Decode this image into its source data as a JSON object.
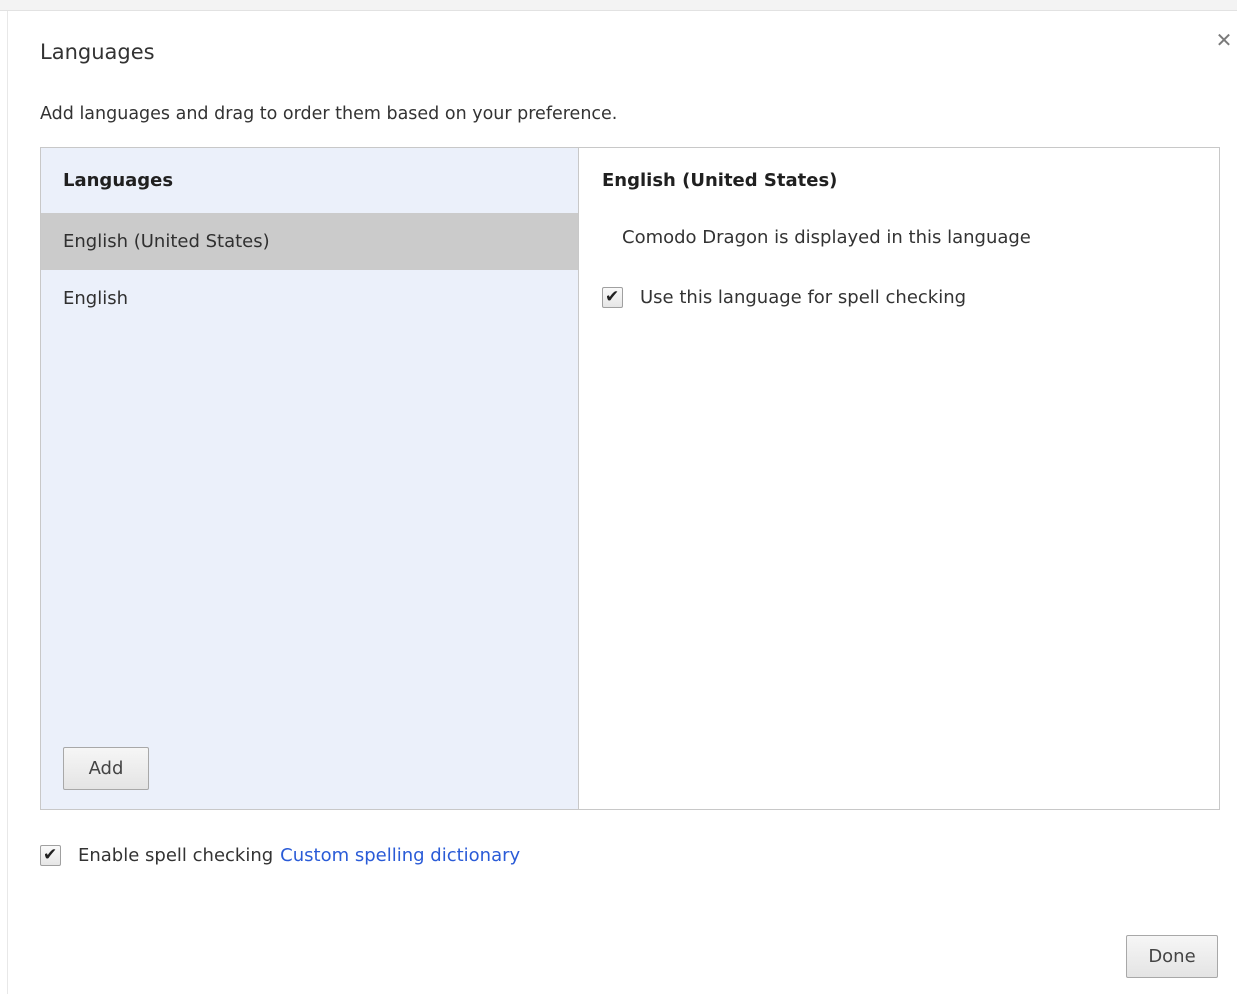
{
  "dialog": {
    "title": "Languages",
    "instructions": "Add languages and drag to order them based on your preference.",
    "close_icon": "close-icon"
  },
  "language_list": {
    "header": "Languages",
    "items": [
      {
        "label": "English (United States)",
        "selected": true
      },
      {
        "label": "English",
        "selected": false
      }
    ],
    "add_label": "Add"
  },
  "details": {
    "header": "English (United States)",
    "display_note": "Comodo Dragon is displayed in this language",
    "spell_check_label": "Use this language for spell checking",
    "spell_check_checked": true
  },
  "footer": {
    "enable_spell_label": "Enable spell checking",
    "enable_spell_checked": true,
    "custom_dictionary_link": "Custom spelling dictionary",
    "done_label": "Done"
  },
  "colors": {
    "list_background": "#ebf0fa",
    "selected_row": "#cbcbcb",
    "link": "#2a5bd7"
  }
}
